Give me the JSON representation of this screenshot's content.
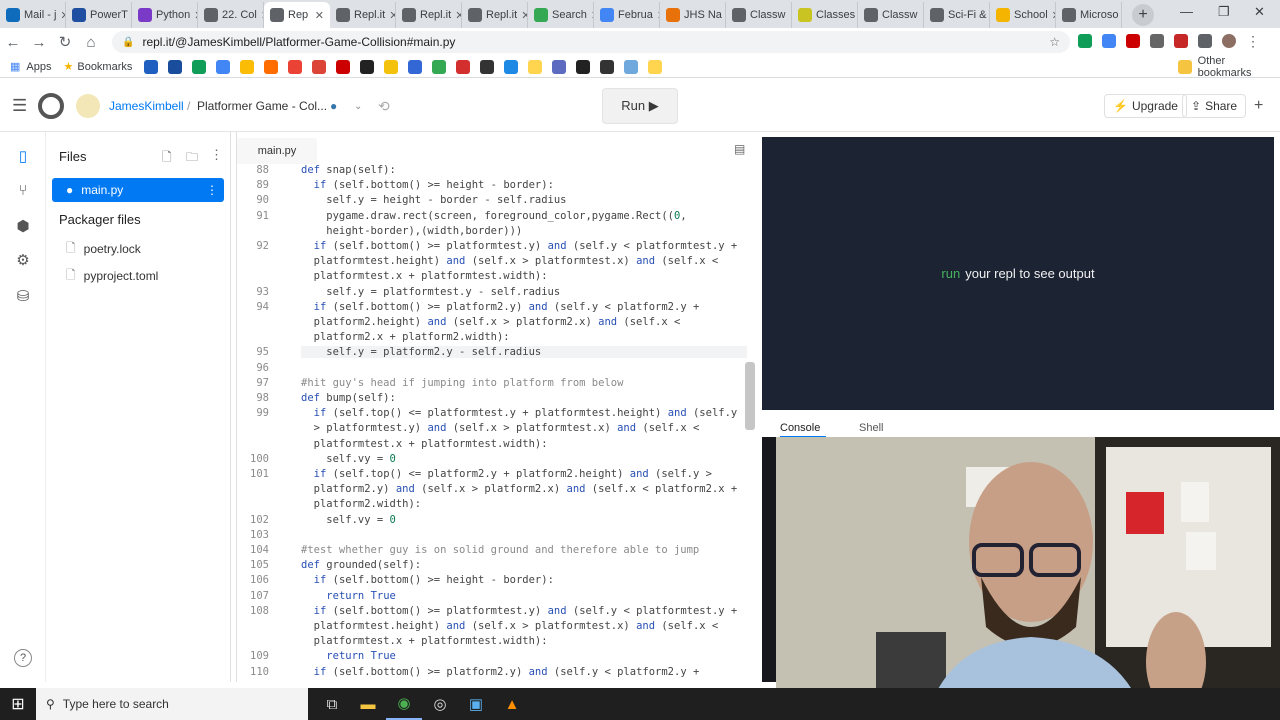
{
  "browser": {
    "tabs": [
      {
        "label": "Mail - j",
        "color": "#0f6cbd"
      },
      {
        "label": "PowerT",
        "color": "#1f4fa0"
      },
      {
        "label": "Python",
        "color": "#7b39c8"
      },
      {
        "label": "22. Col",
        "color": "#5f6368"
      },
      {
        "label": "Rep",
        "color": "#5f6368",
        "active": true
      },
      {
        "label": "Repl.it",
        "color": "#5f6368"
      },
      {
        "label": "Repl.it",
        "color": "#5f6368"
      },
      {
        "label": "Repl.it",
        "color": "#5f6368"
      },
      {
        "label": "Search",
        "color": "#34a853"
      },
      {
        "label": "Februa",
        "color": "#4285f4"
      },
      {
        "label": "JHS Na",
        "color": "#e8710a"
      },
      {
        "label": "Classw",
        "color": "#5f6368"
      },
      {
        "label": "Classes",
        "color": "#c9c422"
      },
      {
        "label": "Classw",
        "color": "#5f6368"
      },
      {
        "label": "Sci-Fi &",
        "color": "#5f6368"
      },
      {
        "label": "School",
        "color": "#f5b400"
      },
      {
        "label": "Microso",
        "color": "#5f6368"
      }
    ],
    "url": "repl.it/@JamesKimbell/Platformer-Game-Collision#main.py",
    "bookmarks": {
      "apps": "Apps",
      "bookmarks": "Bookmarks",
      "other": "Other bookmarks"
    },
    "bookmark_colors": [
      "#1f5fbf",
      "#1a4d9c",
      "#0f9d58",
      "#4285f4",
      "#fbbc05",
      "#ff6d00",
      "#ea4335",
      "#db4437",
      "#c00",
      "#222",
      "#f4c20d",
      "#3367d6",
      "#34a853",
      "#d32f2f",
      "#333",
      "#1e88e5",
      "#ffd54f",
      "#5c6bc0",
      "#222",
      "#333",
      "#6fa8dc",
      "#ffd54f"
    ]
  },
  "replit": {
    "user": "JamesKimbell",
    "separator": "/",
    "project": "Platformer Game - Col...",
    "run_label": "Run ▶",
    "upgrade_label": "Upgrade",
    "share_label": "Share",
    "files_title": "Files",
    "active_file": "main.py",
    "packager_title": "Packager files",
    "packager_files": [
      "poetry.lock",
      "pyproject.toml"
    ],
    "editor_tab": "main.py",
    "output_run_word": "run",
    "output_text": "your repl to see output",
    "console_tab": "Console",
    "shell_tab": "Shell",
    "help_label": "?"
  },
  "code": [
    {
      "n": "88",
      "t": "def snap(self):"
    },
    {
      "n": "89",
      "t": "  if (self.bottom() >= height - border):"
    },
    {
      "n": "90",
      "t": "    self.y = height - border - self.radius"
    },
    {
      "n": "91",
      "t": "    pygame.draw.rect(screen, foreground_color,pygame.Rect((0,"
    },
    {
      "n": "",
      "t": "    height-border),(width,border)))"
    },
    {
      "n": "92",
      "t": "  if (self.bottom() >= platformtest.y) and (self.y < platformtest.y +"
    },
    {
      "n": "",
      "t": "  platformtest.height) and (self.x > platformtest.x) and (self.x <"
    },
    {
      "n": "",
      "t": "  platformtest.x + platformtest.width):"
    },
    {
      "n": "93",
      "t": "    self.y = platformtest.y - self.radius"
    },
    {
      "n": "94",
      "t": "  if (self.bottom() >= platform2.y) and (self.y < platform2.y +"
    },
    {
      "n": "",
      "t": "  platform2.height) and (self.x > platform2.x) and (self.x <"
    },
    {
      "n": "",
      "t": "  platform2.x + platform2.width):"
    },
    {
      "n": "95",
      "t": "    self.y = platform2.y - self.radius",
      "cur": true
    },
    {
      "n": "96",
      "t": ""
    },
    {
      "n": "97",
      "t": "#hit guy's head if jumping into platform from below",
      "cm": true
    },
    {
      "n": "98",
      "t": "def bump(self):"
    },
    {
      "n": "99",
      "t": "  if (self.top() <= platformtest.y + platformtest.height) and (self.y"
    },
    {
      "n": "",
      "t": "  > platformtest.y) and (self.x > platformtest.x) and (self.x <"
    },
    {
      "n": "",
      "t": "  platformtest.x + platformtest.width):"
    },
    {
      "n": "100",
      "t": "    self.vy = 0"
    },
    {
      "n": "101",
      "t": "  if (self.top() <= platform2.y + platform2.height) and (self.y >"
    },
    {
      "n": "",
      "t": "  platform2.y) and (self.x > platform2.x) and (self.x < platform2.x +"
    },
    {
      "n": "",
      "t": "  platform2.width):"
    },
    {
      "n": "102",
      "t": "    self.vy = 0"
    },
    {
      "n": "103",
      "t": ""
    },
    {
      "n": "104",
      "t": "#test whether guy is on solid ground and therefore able to jump",
      "cm": true
    },
    {
      "n": "105",
      "t": "def grounded(self):"
    },
    {
      "n": "106",
      "t": "  if (self.bottom() >= height - border):"
    },
    {
      "n": "107",
      "t": "    return True"
    },
    {
      "n": "108",
      "t": "  if (self.bottom() >= platformtest.y) and (self.y < platformtest.y +"
    },
    {
      "n": "",
      "t": "  platformtest.height) and (self.x > platformtest.x) and (self.x <"
    },
    {
      "n": "",
      "t": "  platformtest.x + platformtest.width):"
    },
    {
      "n": "109",
      "t": "    return True"
    },
    {
      "n": "110",
      "t": "  if (self.bottom() >= platform2.y) and (self.y < platform2.y +"
    }
  ],
  "taskbar": {
    "search_placeholder": "Type here to search"
  },
  "colors": {
    "accent": "#0079f2",
    "output_bg": "#1c2333",
    "run_green": "#44b35c"
  }
}
